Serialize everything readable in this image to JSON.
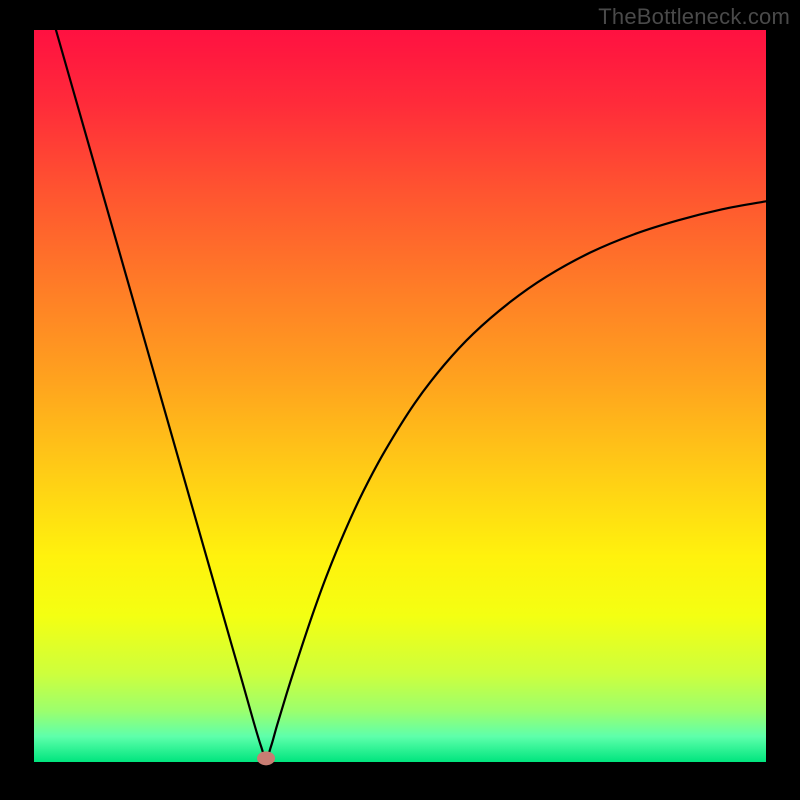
{
  "watermark": "TheBottleneck.com",
  "chart_data": {
    "type": "line",
    "title": "",
    "xlabel": "",
    "ylabel": "",
    "xlim": [
      0,
      100
    ],
    "ylim": [
      0,
      100
    ],
    "background_gradient": {
      "stops": [
        {
          "offset": 0.0,
          "color": "#ff1141"
        },
        {
          "offset": 0.1,
          "color": "#ff2b3a"
        },
        {
          "offset": 0.22,
          "color": "#ff5430"
        },
        {
          "offset": 0.35,
          "color": "#ff7c27"
        },
        {
          "offset": 0.48,
          "color": "#ffa31e"
        },
        {
          "offset": 0.6,
          "color": "#ffcb16"
        },
        {
          "offset": 0.72,
          "color": "#fff20d"
        },
        {
          "offset": 0.8,
          "color": "#f4ff12"
        },
        {
          "offset": 0.88,
          "color": "#cdff3d"
        },
        {
          "offset": 0.93,
          "color": "#9cff6d"
        },
        {
          "offset": 0.965,
          "color": "#5effab"
        },
        {
          "offset": 1.0,
          "color": "#00e57e"
        }
      ]
    },
    "minimum_marker": {
      "x": 31.7,
      "y": 0.5,
      "color": "#c97d73"
    },
    "series": [
      {
        "name": "bottleneck-curve",
        "color": "#000000",
        "x": [
          3.0,
          5.0,
          8.0,
          11.0,
          14.0,
          17.0,
          20.0,
          23.0,
          25.0,
          27.0,
          28.5,
          30.0,
          31.0,
          31.7,
          32.4,
          33.2,
          34.5,
          36.0,
          38.0,
          40.0,
          42.5,
          45.0,
          48.0,
          52.0,
          56.0,
          60.0,
          65.0,
          70.0,
          76.0,
          82.0,
          88.0,
          94.0,
          100.0
        ],
        "values": [
          100.0,
          93.0,
          82.5,
          72.0,
          61.5,
          51.0,
          40.5,
          30.0,
          23.0,
          16.0,
          10.8,
          5.5,
          2.2,
          0.5,
          2.2,
          5.0,
          9.3,
          14.0,
          20.0,
          25.5,
          31.6,
          37.0,
          42.6,
          49.0,
          54.2,
          58.5,
          62.8,
          66.3,
          69.6,
          72.1,
          74.0,
          75.5,
          76.6
        ]
      }
    ]
  }
}
